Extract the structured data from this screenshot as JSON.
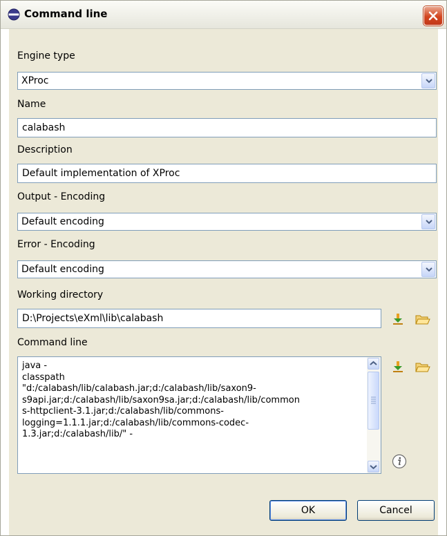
{
  "window": {
    "title": "Command line",
    "close_icon": "close-icon"
  },
  "form": {
    "engine_type": {
      "label": "Engine type",
      "value": "XProc"
    },
    "name": {
      "label": "Name",
      "value": "calabash"
    },
    "description": {
      "label": "Description",
      "value": "Default implementation of XProc"
    },
    "output_encoding": {
      "label": "Output - Encoding",
      "value": "Default encoding"
    },
    "error_encoding": {
      "label": "Error - Encoding",
      "value": "Default encoding"
    },
    "working_directory": {
      "label": "Working directory",
      "value": "D:\\Projects\\eXml\\lib\\calabash"
    },
    "command_line": {
      "label": "Command line",
      "lines": [
        "java -",
        "classpath",
        "\"d:/calabash/lib/calabash.jar;d:/calabash/lib/saxon9-",
        "s9api.jar;d:/calabash/lib/saxon9sa.jar;d:/calabash/lib/common",
        "s-httpclient-3.1.jar;d:/calabash/lib/commons-",
        "logging=1.1.1.jar;d:/calabash/lib/commons-codec-",
        "1.3.jar;d:/calabash/lib/\" -"
      ]
    }
  },
  "buttons": {
    "ok": "OK",
    "cancel": "Cancel"
  },
  "colors": {
    "dialog_bg": "#ece9d8",
    "field_border": "#7f9db9",
    "close_red": "#d2451f"
  }
}
